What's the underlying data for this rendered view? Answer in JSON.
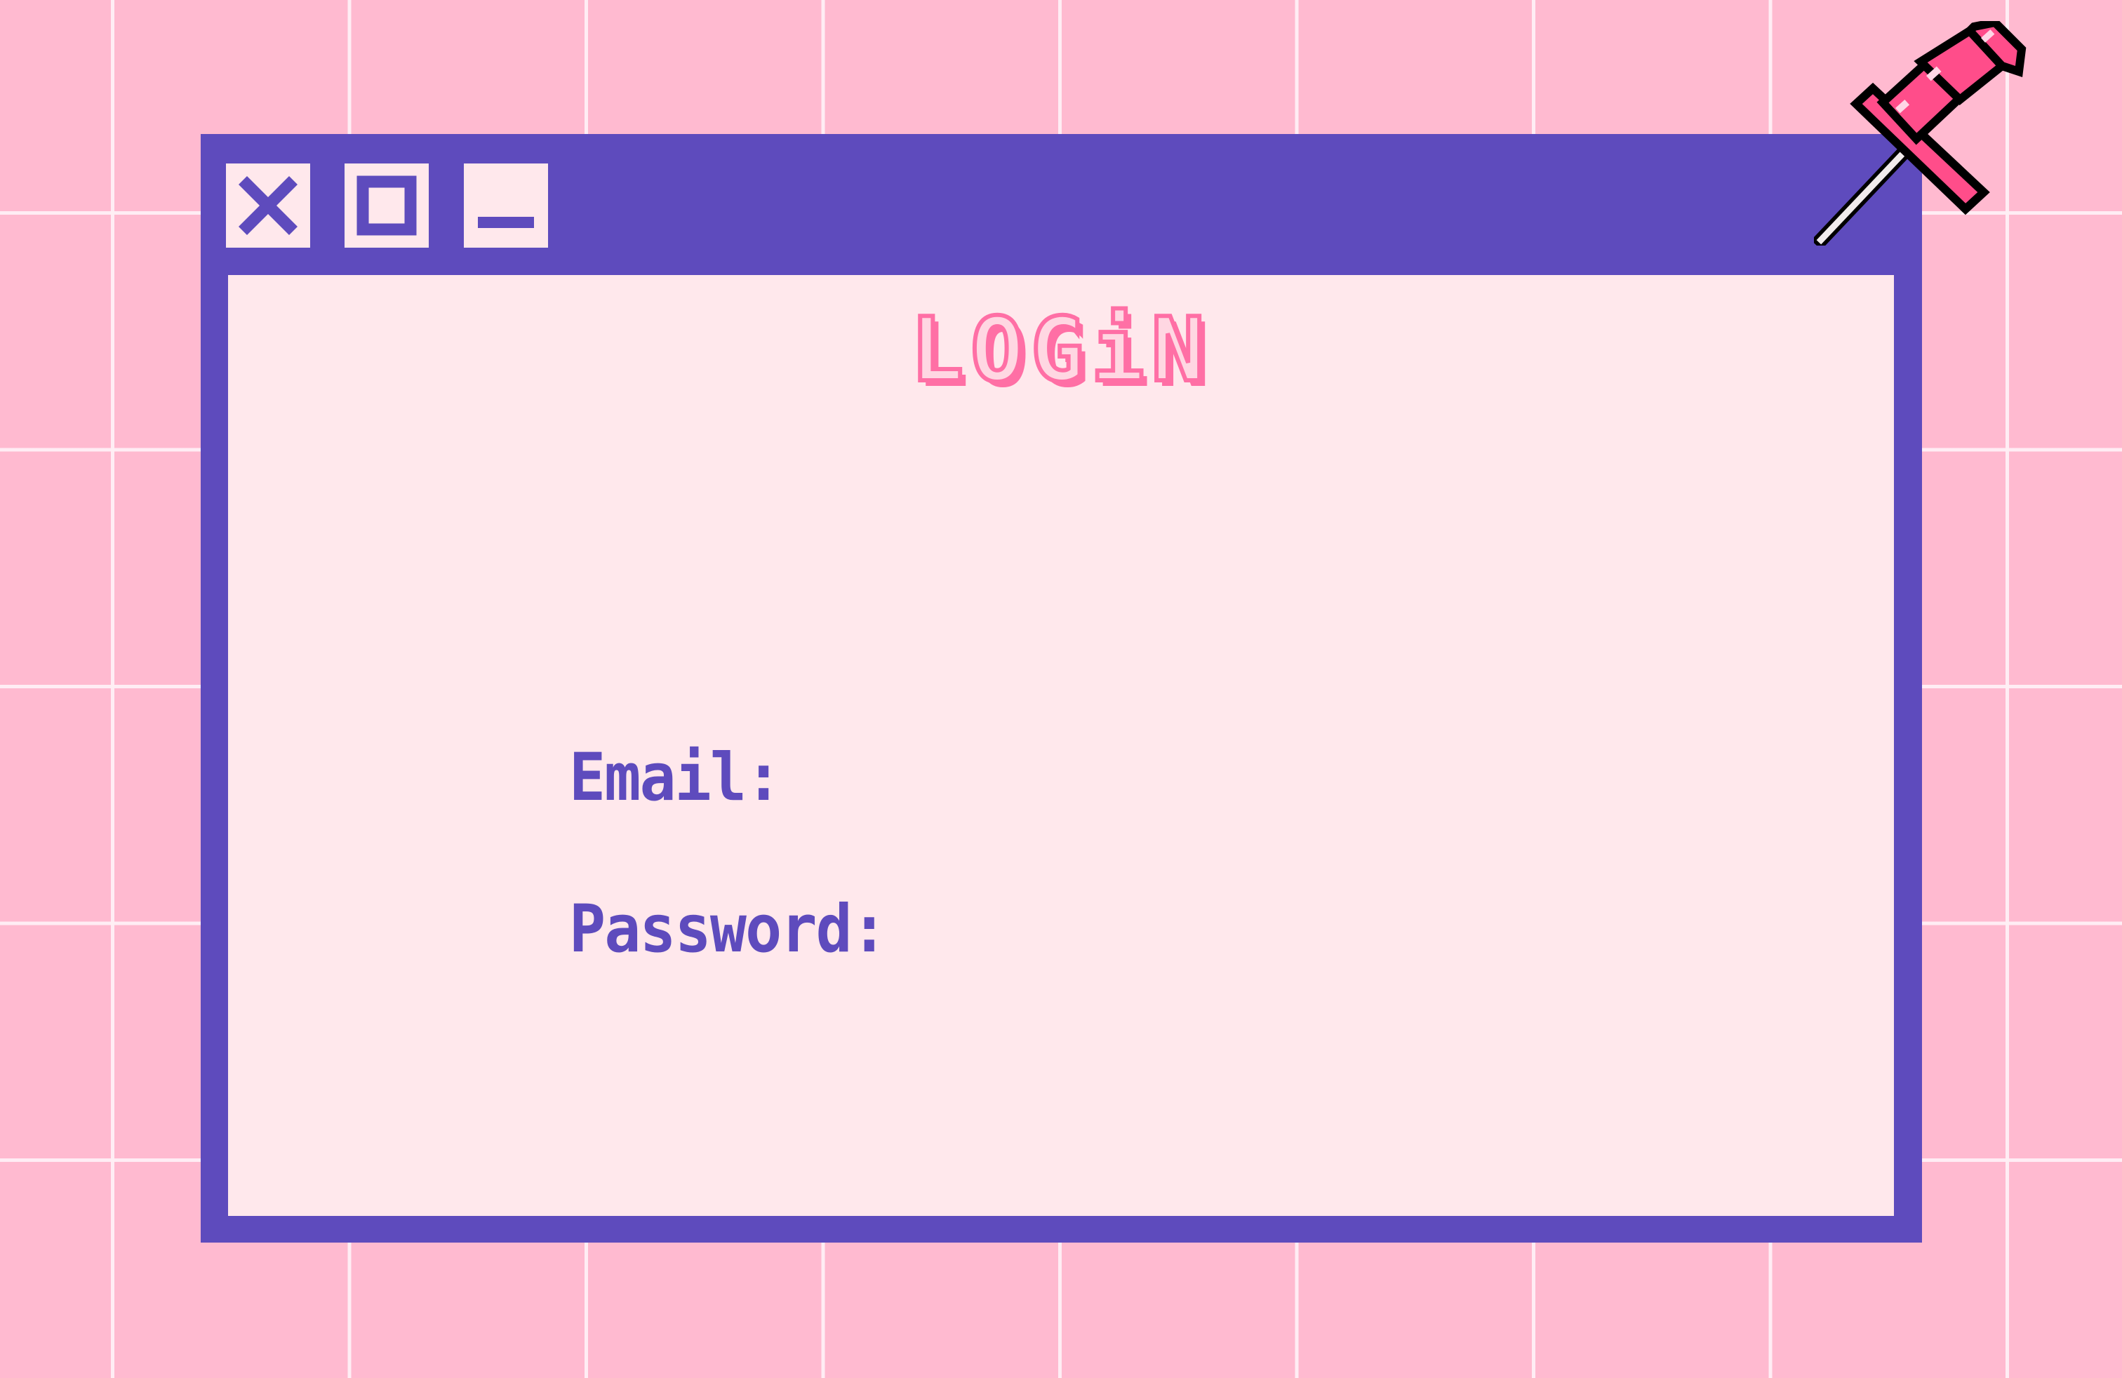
{
  "window": {
    "title": "LOGiN",
    "controls": {
      "close_icon": "close-icon",
      "maximize_icon": "maximize-icon",
      "minimize_icon": "minimize-icon"
    }
  },
  "form": {
    "email_label": "Email:",
    "email_value": "",
    "password_label": "Password:",
    "password_value": ""
  },
  "decorations": {
    "pin_icon": "pushpin-icon"
  },
  "colors": {
    "background": "#ffbad0",
    "grid_lines": "#fff0f5",
    "window_frame": "#5e4bbd",
    "window_content": "#ffe8ec",
    "title_pink": "#ff6fa5",
    "label_purple": "#5e4bbd"
  }
}
